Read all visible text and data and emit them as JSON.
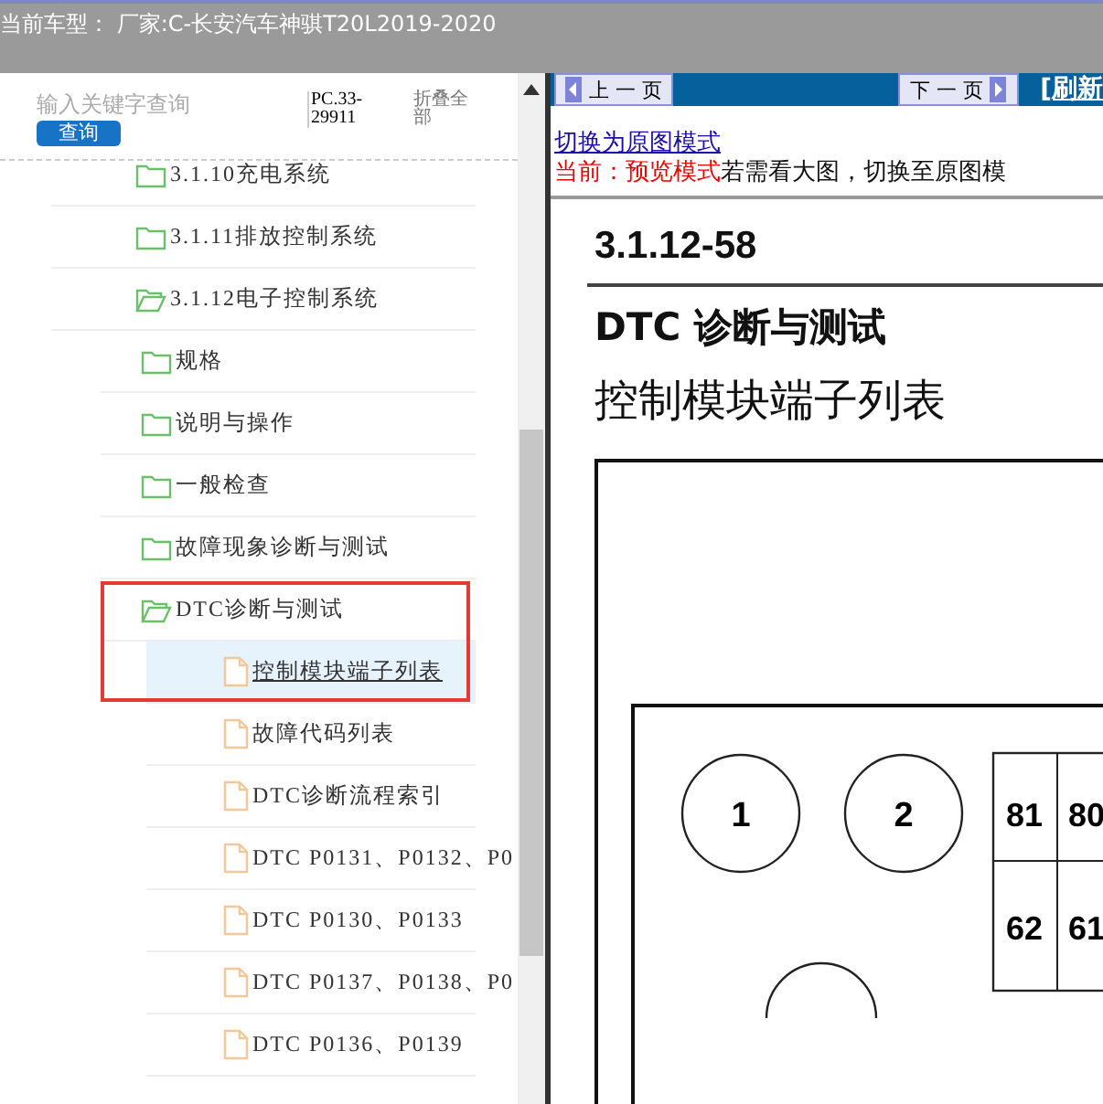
{
  "header": {
    "title": "当前车型： 厂家:C-长安汽车神骐T20L2019-2020"
  },
  "search": {
    "placeholder": "输入关键字查询",
    "button": "查询",
    "code": "PC.33-29911",
    "collapse_all": "折叠全部"
  },
  "tree": [
    {
      "label": "3.1.10充电系统",
      "kind": "folder",
      "expanded": false
    },
    {
      "label": "3.1.11排放控制系统",
      "kind": "folder",
      "expanded": false
    },
    {
      "label": "3.1.12电子控制系统",
      "kind": "folder",
      "expanded": true,
      "children": [
        {
          "label": "规格",
          "kind": "folder",
          "expanded": false
        },
        {
          "label": "说明与操作",
          "kind": "folder",
          "expanded": false
        },
        {
          "label": "一般检查",
          "kind": "folder",
          "expanded": false
        },
        {
          "label": "故障现象诊断与测试",
          "kind": "folder",
          "expanded": false
        },
        {
          "label": "DTC诊断与测试",
          "kind": "folder",
          "expanded": true,
          "children": [
            {
              "label": "控制模块端子列表",
              "kind": "file",
              "selected": true
            },
            {
              "label": "故障代码列表",
              "kind": "file",
              "selected": false
            },
            {
              "label": "DTC诊断流程索引",
              "kind": "file",
              "selected": false
            },
            {
              "label": "DTC P0131、P0132、P0",
              "kind": "file",
              "selected": false
            },
            {
              "label": "DTC P0130、P0133",
              "kind": "file",
              "selected": false
            },
            {
              "label": "DTC P0137、P0138、P0",
              "kind": "file",
              "selected": false
            },
            {
              "label": "DTC P0136、P0139",
              "kind": "file",
              "selected": false
            }
          ]
        }
      ]
    }
  ],
  "toolbar": {
    "prev": "上 一 页",
    "next": "下 一 页",
    "refresh": "[刷新"
  },
  "mode_link": "切换为原图模式",
  "notice": {
    "current": "当前：预览模式",
    "hint": "若需看大图，切换至原图模"
  },
  "document": {
    "page": "3.1.12-58",
    "section": "DTC 诊断与测试",
    "heading": "控制模块端子列表",
    "pins": [
      "1",
      "2"
    ],
    "grid": [
      [
        "81",
        "80"
      ],
      [
        "62",
        "61"
      ]
    ]
  }
}
